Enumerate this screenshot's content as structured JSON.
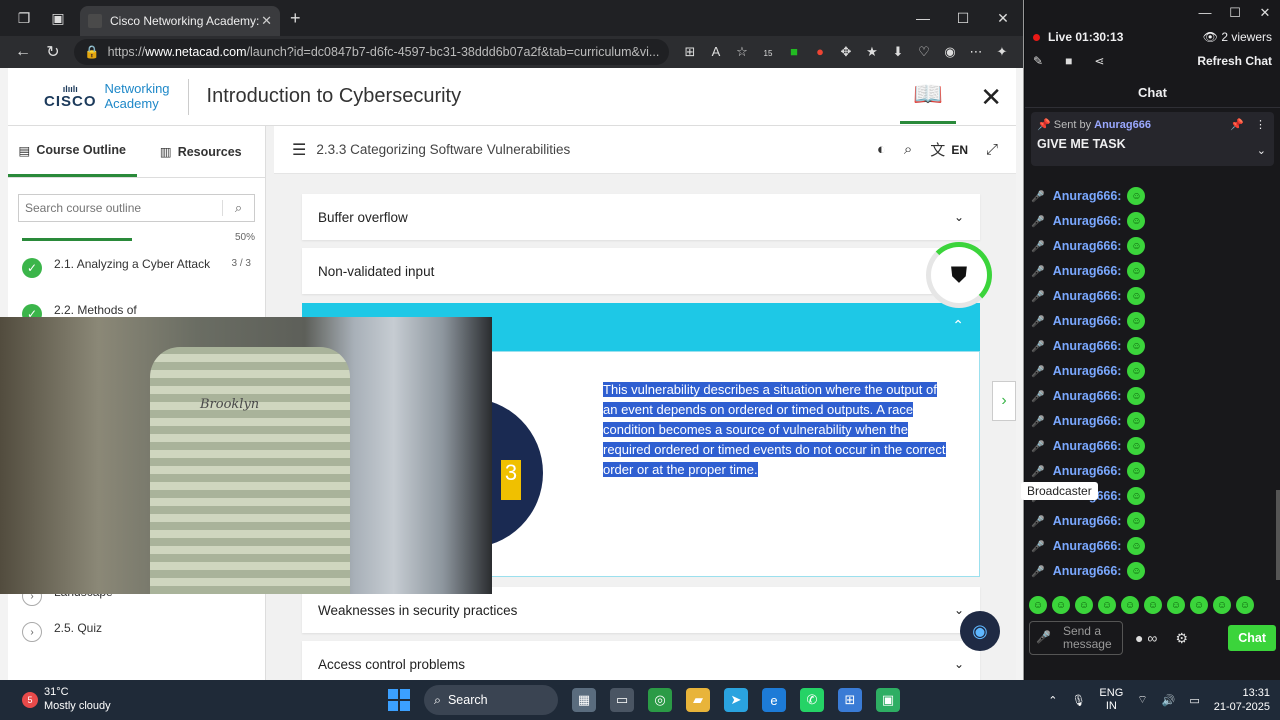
{
  "browser": {
    "tab_title": "Cisco Networking Academy: Intro",
    "url_prefix": "https://",
    "url_host": "www.netacad.com",
    "url_rest": "/launch?id=dc0847b7-d6fc-4597-bc31-38ddd6b07a2f&tab=curriculum&vi...",
    "ext_badge": "15"
  },
  "page": {
    "logo_brand": "CISCO",
    "logo_line1": "Networking",
    "logo_line2": "Academy",
    "course_title": "Introduction to Cybersecurity"
  },
  "sidebar": {
    "tab_outline": "Course Outline",
    "tab_resources": "Resources",
    "search_placeholder": "Search course outline",
    "progress_pct": "50%",
    "modules": [
      {
        "name": "2.1. Analyzing a Cyber Attack",
        "count": "3 / 3"
      },
      {
        "name": "2.2. Methods of",
        "count": ""
      },
      {
        "name": "Landscape",
        "count": ""
      },
      {
        "name": "2.5. Quiz",
        "count": ""
      }
    ]
  },
  "content": {
    "topic": "2.3.3 Categorizing Software Vulnerabilities",
    "lang": "EN",
    "accordions": [
      "Buffer overflow",
      "Non-validated input",
      "Weaknesses in security practices",
      "Access control problems"
    ],
    "open_text": "This vulnerability describes a situation where the output of an event depends on ordered or timed outputs. A race condition becomes a source of vulnerability when the required ordered or timed events do not occur in the correct order or at the proper time.",
    "art_digit": "3"
  },
  "webcam": {
    "shirt_text": "Brooklyn"
  },
  "stream": {
    "live_label": "Live",
    "live_time": "01:30:13",
    "viewers": "2 viewers",
    "refresh": "Refresh Chat",
    "chat_title": "Chat",
    "pinned_by_label": "Sent by",
    "pinned_user": "Anurag666",
    "pinned_msg": "GIVE ME TASK",
    "chat_user": "Anurag666:",
    "tooltip": "Broadcaster",
    "send_placeholder": "Send a message",
    "chat_button": "Chat"
  },
  "taskbar": {
    "weather_badge": "5",
    "temp": "31°C",
    "weather": "Mostly cloudy",
    "search": "Search",
    "lang1": "ENG",
    "lang2": "IN",
    "time": "13:31",
    "date": "21-07-2025"
  }
}
